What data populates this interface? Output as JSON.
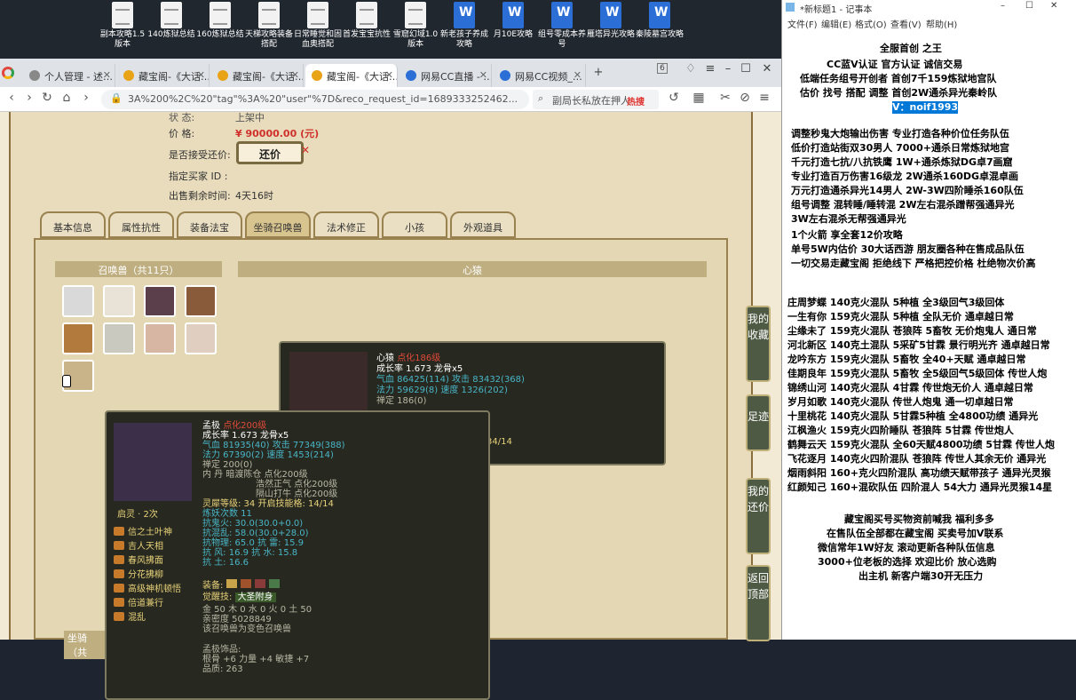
{
  "desktop": {
    "icons": [
      {
        "label": "副本攻略1.5 版本",
        "type": "txt"
      },
      {
        "label": "140炼狱总结",
        "type": "txt"
      },
      {
        "label": "160炼狱总结",
        "type": "txt"
      },
      {
        "label": "天梯攻略装备搭配",
        "type": "txt"
      },
      {
        "label": "日常睡觉和固血奥搭配",
        "type": "txt"
      },
      {
        "label": "首发宝宝抗性",
        "type": "txt"
      },
      {
        "label": "雪窟幻域1.0 版本",
        "type": "txt"
      },
      {
        "label": "新老孩子养成攻略",
        "type": "word"
      },
      {
        "label": "月10E攻略",
        "type": "word"
      },
      {
        "label": "组号零成本养号",
        "type": "word"
      },
      {
        "label": "雁塔异光攻略",
        "type": "word"
      },
      {
        "label": "秦陵墓宫攻略",
        "type": "word"
      }
    ]
  },
  "browser": {
    "tabs": [
      "个人管理 - 述…",
      "藏宝阁-《大话…",
      "藏宝阁-《大话…",
      "藏宝阁-《大话…",
      "网易CC直播 - …",
      "网易CC视频_…"
    ],
    "tab_count": "6",
    "url": "3A%200%2C%20\"tag\"%3A%20\"user\"%7D&reco_request_id=1689333252462...",
    "search_text": "副局长私放在押人",
    "hot_label": "热搜"
  },
  "page": {
    "status_label": "状 态:",
    "status_value": "上架中",
    "price_label": "价 格:",
    "price_value": "¥ 90000.00 (元)",
    "counter_label": "是否接受还价:",
    "counter_button": "还价",
    "buyer_label": "指定买家 ID :",
    "buyer_value": "",
    "remain_label": "出售剩余时间:",
    "remain_value": "4天16时",
    "tabs": [
      "基本信息",
      "属性抗性",
      "装备法宝",
      "坐骑召唤兽",
      "法术修正",
      "小孩",
      "外观道具"
    ],
    "summon_header": "召唤兽（共11只）",
    "right_header": "心猿",
    "mount_header": "坐骑（共",
    "side_buttons": [
      "我的收藏",
      "足迹",
      "我的还价",
      "返回顶部"
    ]
  },
  "tip1": {
    "name": "心猿",
    "level": "点化186级",
    "growth": "成长率 1.673 龙骨x5",
    "qi": "气血 86425(114) 攻击 83432(368)",
    "fa": "法力 59629(8) 速度 1326(202)",
    "chan": "禅定 186(0)",
    "extra": "34/14"
  },
  "tip2": {
    "name": "孟极",
    "level": "点化200级",
    "growth": "成长率 1.673 龙骨x5",
    "qi": "气血 81935(40) 攻击 77349(388)",
    "fa": "法力 67390(2) 速度 1453(214)",
    "chan": "禅定 200(0)",
    "nei1": "内 丹 暗渡陈仓 点化200级",
    "nei2": "浩然正气 点化200级",
    "nei3": "隔山打牛 点化200级",
    "ling": "灵犀等级: 34 开启技能格: 14/14",
    "lian": "炼妖次数 11",
    "k1": "抗鬼火: 30.0(30.0+0.0)",
    "k2": "抗混乱: 58.0(30.0+28.0)",
    "k3": "抗物理: 65.0 抗 雷: 15.9",
    "k4": "抗 风: 16.9 抗 水: 15.8",
    "k5": "抗 土: 16.6",
    "equip": "装备:",
    "jue": "觉醒技:",
    "jue_val": "大圣附身",
    "wx": "金 50 木 0 水 0 火 0 土 50",
    "num": "亲密度 5028849",
    "bind": "该召唤兽为变色召唤兽",
    "orn": "孟极饰品:",
    "orn1": "根骨 +6 力量 +4 敏捷 +7",
    "orn2": "品质: 263",
    "badge": "启灵 · 2次",
    "skills": [
      "信之土叶神",
      "吉人天相",
      "春风拂面",
      "分花拂柳",
      "高级神机顿悟",
      "倍道兼行",
      "混乱"
    ]
  },
  "notepad": {
    "title": "*新标题1 - 记事本",
    "menu": [
      "文件(F)",
      "编辑(E)",
      "格式(O)",
      "查看(V)",
      "帮助(H)"
    ],
    "lines": [
      "全服首创 之王",
      "CC蓝V认证 官方认证 诚信交易",
      "低端任务组号开创者            首创7千159炼狱地宫队",
      "估价 找号 搭配 调整           首创2W通杀异光秦岭队",
      "V：noif1993",
      "调整秒鬼大炮输出伤害        专业打造各种价位任务队伍",
      "低价打造站街双30男人          7000+通杀日常炼狱地宫",
      "千元打造七抗/八抗铁鹰       1W+通杀炼狱DG卓7画窟",
      "专业打造百万伤害16级龙       2W通杀160DG卓混卓画",
      "万元打造通杀异光14男人      2W-3W四阶睡杀160队伍",
      "组号调整 混转睡/睡转混        2W左右混杀蹭帮强通异光",
      "                                        3W左右混杀无帮强通异光",
      "1个火箭 享全套12价攻略",
      "单号5W内估价 30大话西游        朋友圈各种在售成品队伍",
      "一切交易走藏宝阁 拒绝线下    严格把控价格 杜绝物次价高",
      "庄周梦蝶 140克火混队 5种植 全3级回气3级回体",
      "一生有你 159克火混队 5种植 全队无价 通卓越日常",
      "尘缘未了 159克火混队 苍狼阵 5畜牧 无价炮鬼人 通日常",
      "河北新区 140克土混队 5采矿5甘霖 景行明光齐 通卓越日常",
      "龙吟东方 159克火混队 5畜牧 全40+天赋 通卓越日常",
      "佳期良年 159克火混队 5畜牧 全5级回气5级回体 传世人炮",
      "锦绣山河 140克火混队 4甘霖 传世炮无价人 通卓越日常",
      "岁月如歌 140克火混队 传世人炮鬼 通一切卓越日常",
      "十里桃花 140克火混队 5甘霖5种植 全4800功绩 通异光",
      "江枫渔火 159克火四阶睡队 苍狼阵 5甘霖 传世炮人",
      "鹤舞云天 159克火混队 全60天赋4800功绩 5甘霖 传世人炮",
      "飞花逐月 140克火四阶混队 苍狼阵 传世人其余无价 通异光",
      "烟雨斜阳 160+克火四阶混队 高功绩天赋带孩子 通异光灵猴",
      "红颜知己 160+混砍队伍 四阶混人 54大力 通异光灵猴14星",
      "藏宝阁买号买物资前喊我 福利多多",
      "在售队伍全部都在藏宝阁 买卖号加V联系",
      "微信常年1W好友 滚动更新各种队伍信息",
      "3000+位老板的选择 欢迎比价 放心选购",
      "出主机 新客户端30开无压力"
    ]
  }
}
